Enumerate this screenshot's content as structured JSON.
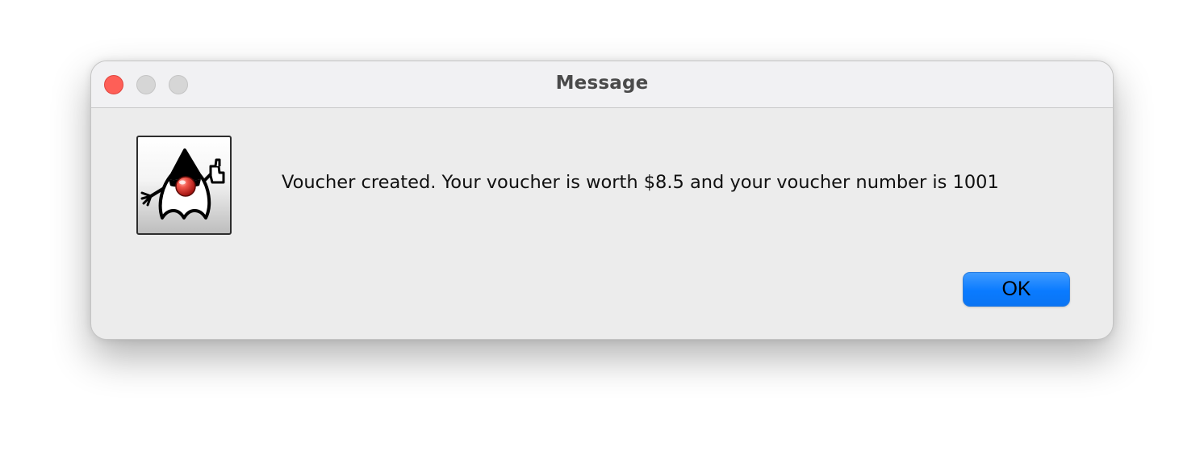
{
  "window": {
    "title": "Message"
  },
  "dialog": {
    "icon": "java-duke-icon",
    "message": "Voucher created. Your voucher is worth $8.5 and your voucher number is 1001",
    "ok_label": "OK"
  },
  "colors": {
    "close_button": "#fe5f57",
    "inactive_traffic": "#d6d6d6",
    "ok_button": "#0a7bff",
    "window_bg": "#ececec"
  }
}
